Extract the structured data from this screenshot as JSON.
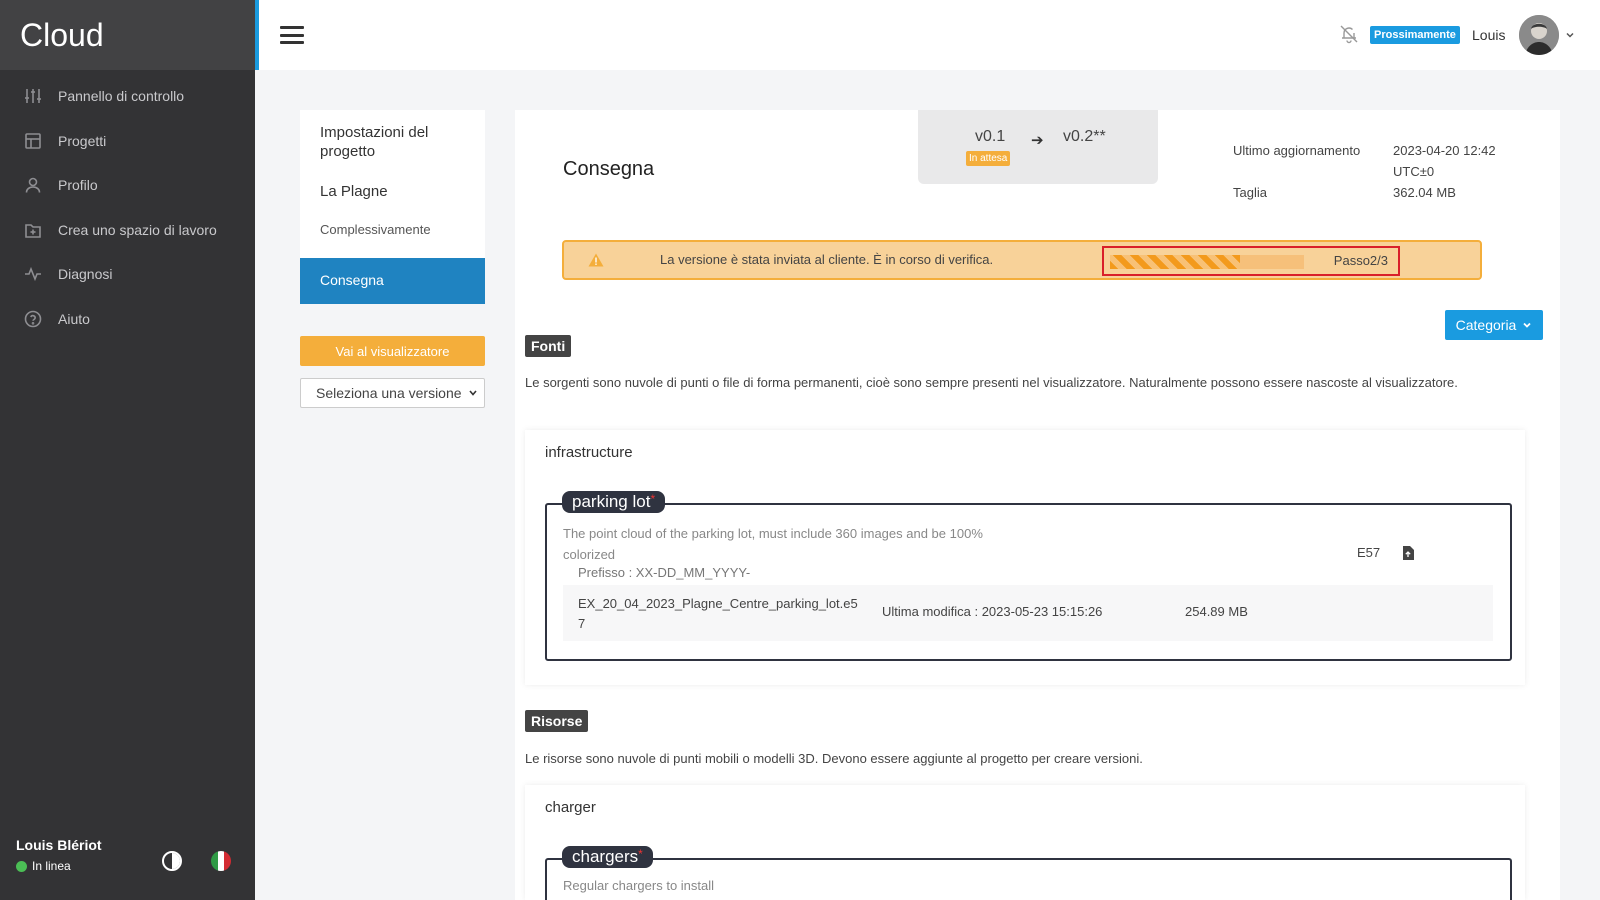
{
  "sidebar": {
    "brand": "Cloud",
    "items": [
      {
        "label": "Pannello di controllo",
        "icon": "sliders-icon"
      },
      {
        "label": "Progetti",
        "icon": "layout-icon"
      },
      {
        "label": "Profilo",
        "icon": "user-icon"
      },
      {
        "label": "Crea uno spazio di lavoro",
        "icon": "folder-plus-icon"
      },
      {
        "label": "Diagnosi",
        "icon": "activity-icon"
      },
      {
        "label": "Aiuto",
        "icon": "help-circle-icon"
      }
    ],
    "user_name": "Louis Blériot",
    "status": "In linea"
  },
  "topbar": {
    "soon_badge": "Prossimamente",
    "user": "Louis"
  },
  "settings": {
    "title": "Impostazioni del progetto",
    "project": "La Plagne",
    "overall": "Complessivamente",
    "delivery": "Consegna",
    "viewer_button": "Vai al visualizzatore",
    "version_select": "Seleziona una versione"
  },
  "main": {
    "title": "Consegna",
    "version_from": "v0.1",
    "version_to": "v0.2**",
    "pending_badge": "In attesa",
    "meta": {
      "last_update_label": "Ultimo aggiornamento",
      "last_update_value": "2023-04-20 12:42 UTC±0",
      "size_label": "Taglia",
      "size_value": "362.04 MB"
    },
    "alert": {
      "text": "La versione è stata inviata al cliente. È in corso di verifica.",
      "step_label": "Passo2/3",
      "progress": 0.67
    },
    "category_button": "Categoria",
    "sources": {
      "tag": "Fonti",
      "description": "Le sorgenti sono nuvole di punti o file di forma permanenti, cioè sono sempre presenti nel visualizzatore. Naturalmente possono essere nascoste al visualizzatore.",
      "group_title": "infrastructure",
      "item": {
        "name": "parking lot",
        "required_mark": "*",
        "description": "The point cloud of the parking lot, must include 360 images and be 100% colorized",
        "prefix": "Prefisso : XX-DD_MM_YYYY-",
        "extension": "E57",
        "file_name": "EX_20_04_2023_Plagne_Centre_parking_lot.e57",
        "modified": "Ultima modifica : 2023-05-23 15:15:26",
        "file_size": "254.89 MB"
      }
    },
    "resources": {
      "tag": "Risorse",
      "description": "Le risorse sono nuvole di punti mobili o modelli 3D. Devono essere aggiunte al progetto per creare versioni.",
      "group_title": "charger",
      "item": {
        "name": "chargers",
        "required_mark": "*",
        "description": "Regular chargers to install"
      }
    }
  },
  "colors": {
    "sidebar_bg": "#333335",
    "accent_blue": "#1a9be0",
    "active_blue": "#1f83c1",
    "warning_orange": "#f4ae3b",
    "highlight_red": "#d9202a"
  }
}
